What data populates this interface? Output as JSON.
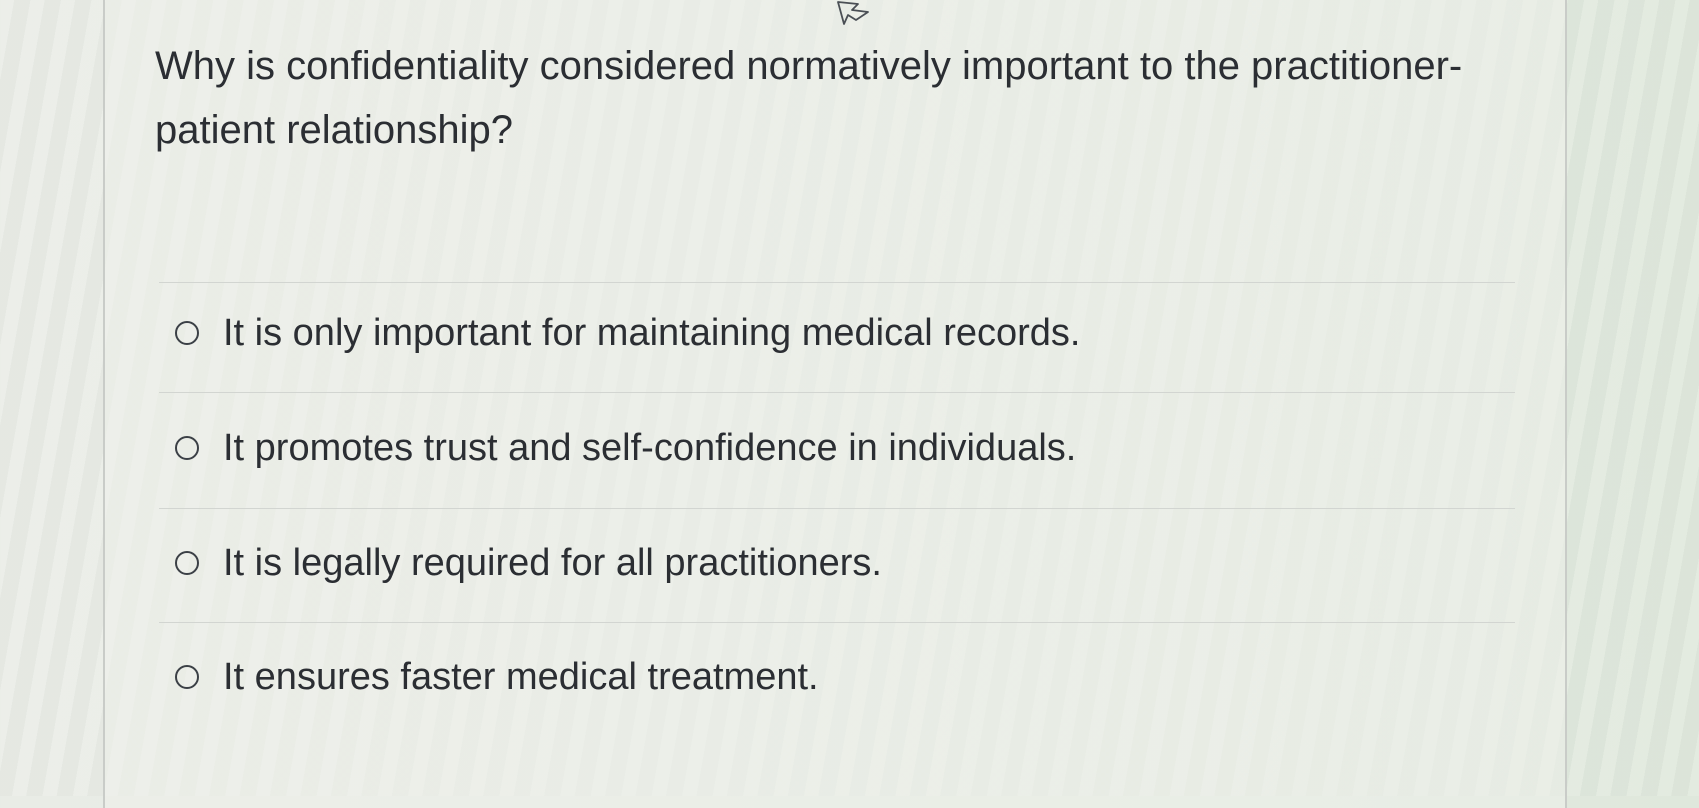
{
  "question": {
    "text": "Why is confidentiality considered normatively important to the practitioner-patient relationship?"
  },
  "options": [
    {
      "label": "It is only important for maintaining medical records.",
      "selected": false
    },
    {
      "label": "It promotes trust and self-confidence in individuals.",
      "selected": false
    },
    {
      "label": "It is legally required for all practitioners.",
      "selected": false
    },
    {
      "label": "It ensures faster medical treatment.",
      "selected": false
    }
  ],
  "colors": {
    "text": "#2b2e33",
    "radio_border": "#3b4046",
    "divider": "#d2d5d1",
    "card_border": "#c9ccc8"
  },
  "icons": {
    "cursor": "pointer-cursor-icon",
    "radio": "radio-unselected-icon"
  }
}
